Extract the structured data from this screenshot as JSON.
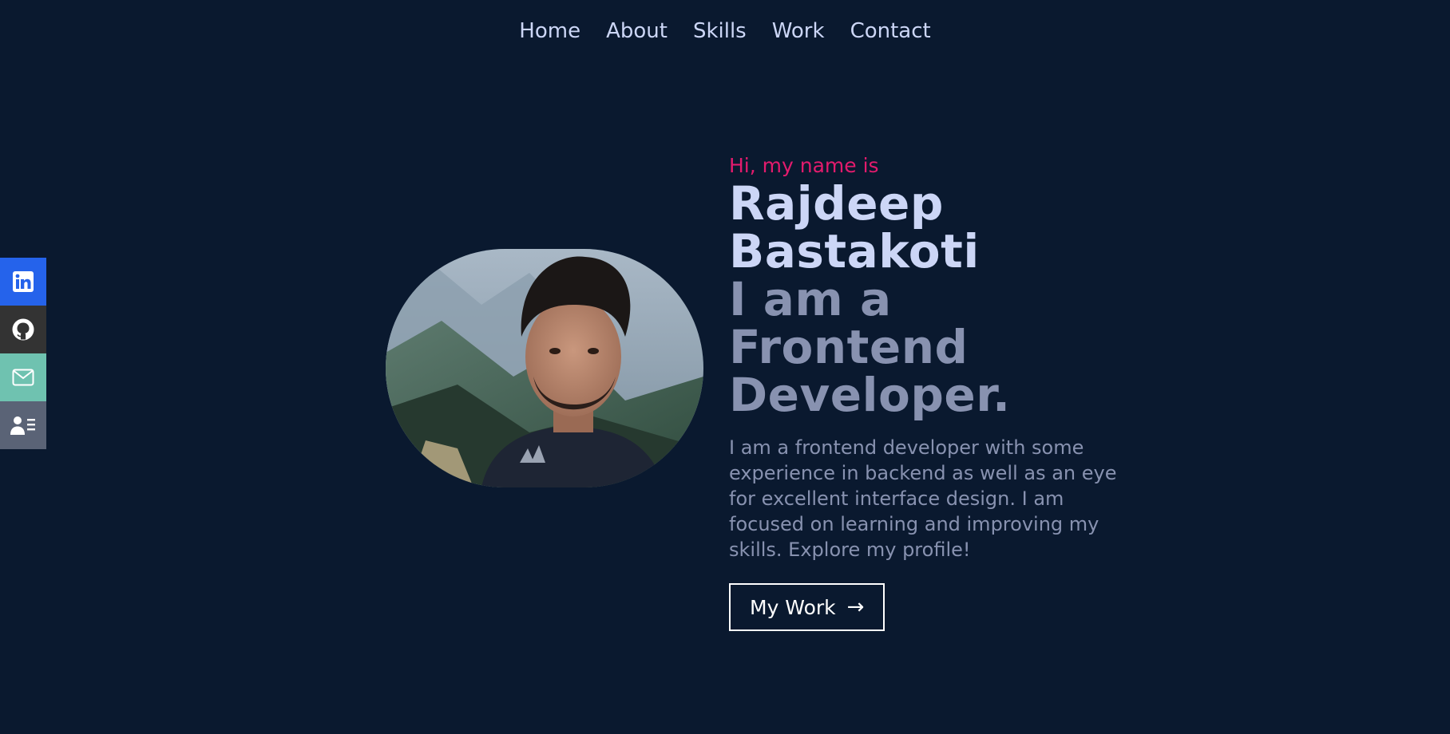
{
  "nav": {
    "items": [
      {
        "label": "Home"
      },
      {
        "label": "About"
      },
      {
        "label": "Skills"
      },
      {
        "label": "Work"
      },
      {
        "label": "Contact"
      }
    ]
  },
  "social": {
    "items": [
      {
        "icon": "linkedin-icon",
        "color": "#2563eb"
      },
      {
        "icon": "github-icon",
        "color": "#333333"
      },
      {
        "icon": "mail-icon",
        "color": "#6fc2b0"
      },
      {
        "icon": "resume-icon",
        "color": "#5a6376"
      }
    ]
  },
  "hero": {
    "greeting": "Hi, my name is",
    "name_line1": "Rajdeep",
    "name_line2": "Bastakoti",
    "role_line1": "I am a Frontend",
    "role_line2": "Developer.",
    "bio": "I am a frontend developer with some experience in backend as well as an eye for excellent interface design. I am focused on learning and improving my skills. Explore my profile!",
    "cta_label": "My Work",
    "cta_arrow": "→"
  },
  "colors": {
    "background": "#0a192f",
    "accent": "#e31b6d",
    "heading": "#ccd6f6",
    "muted": "#8892b0"
  }
}
